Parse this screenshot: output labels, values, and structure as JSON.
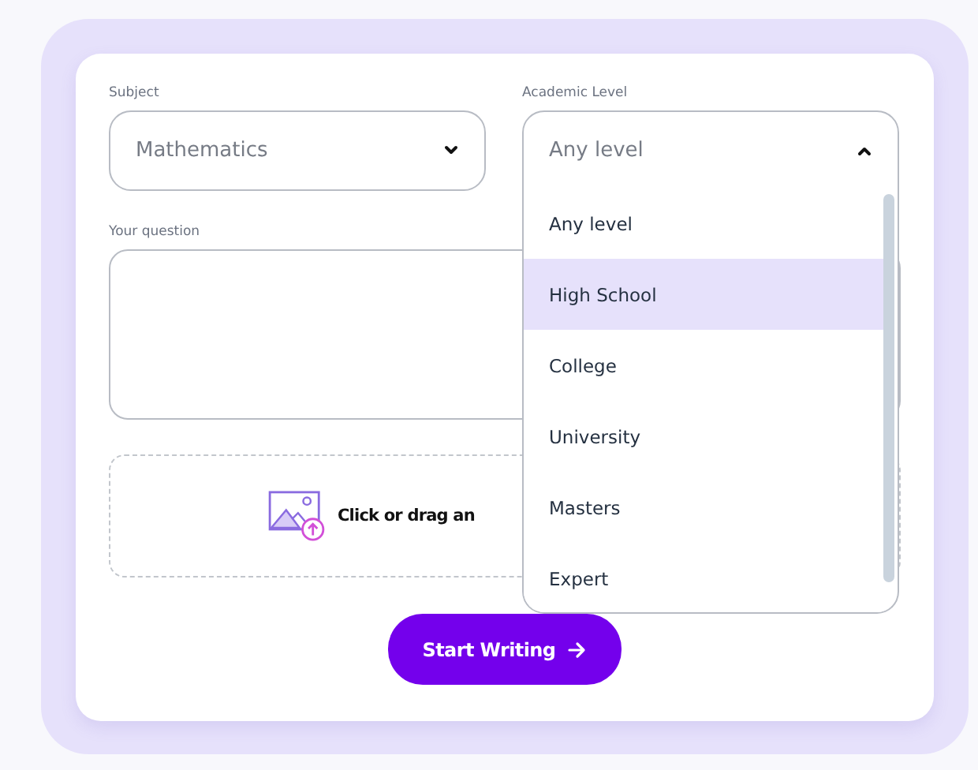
{
  "subject": {
    "label": "Subject",
    "value": "Mathematics",
    "expanded": false
  },
  "level": {
    "label": "Academic Level",
    "value": "Any level",
    "expanded": true,
    "options": [
      {
        "label": "Any level",
        "highlighted": false
      },
      {
        "label": "High School",
        "highlighted": true
      },
      {
        "label": "College",
        "highlighted": false
      },
      {
        "label": "University",
        "highlighted": false
      },
      {
        "label": "Masters",
        "highlighted": false
      },
      {
        "label": "Expert",
        "highlighted": false
      }
    ]
  },
  "question": {
    "label": "Your question"
  },
  "upload": {
    "text": "Click or drag an"
  },
  "submit": {
    "label": "Start Writing"
  }
}
